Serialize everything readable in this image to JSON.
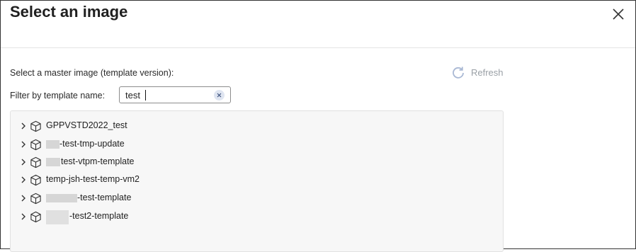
{
  "dialog": {
    "title": "Select an image",
    "close_icon": "close-icon"
  },
  "form": {
    "master_label": "Select a master image (template version):",
    "refresh_label": "Refresh",
    "refresh_icon": "refresh-icon",
    "filter_label": "Filter by template name:",
    "filter_value": "test",
    "clear_icon": "clear-icon"
  },
  "tree": {
    "items": [
      {
        "label": "GPPVSTD2022_test",
        "icon": "image-cube-icon"
      },
      {
        "label": "-test-tmp-update",
        "icon": "image-cube-icon"
      },
      {
        "label": "test-vtpm-template",
        "icon": "image-cube-icon"
      },
      {
        "label": "temp-jsh-test-temp-vm2",
        "icon": "image-cube-icon"
      },
      {
        "label": "-test-template",
        "icon": "image-cube-icon"
      },
      {
        "label": "-test2-template",
        "icon": "image-cube-icon"
      }
    ]
  },
  "colors": {
    "panel_bg": "#f7f7f7",
    "muted": "#9aa0a6",
    "clear_bg": "#dfe5f1"
  }
}
